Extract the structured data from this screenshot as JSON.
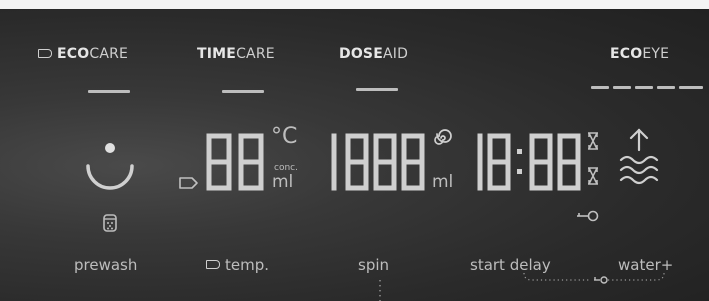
{
  "header": {
    "ecocare": {
      "bold": "ECO",
      "light": "CARE"
    },
    "timecare": {
      "bold": "TIME",
      "light": "CARE"
    },
    "doseaid": {
      "bold": "DOSE",
      "light": "AID"
    },
    "ecoeye": {
      "bold": "ECO",
      "light": "EYE"
    }
  },
  "displays": {
    "temperature": {
      "digits": "88",
      "unit": "°C",
      "sub_unit_small": "conc.",
      "sub_unit": "ml"
    },
    "dose": {
      "digits": "1888",
      "unit": "ml"
    },
    "time": {
      "digits": "18:88"
    }
  },
  "buttons": {
    "prewash": "prewash",
    "temp": "temp.",
    "spin": "spin",
    "start_delay": "start delay",
    "water_plus": "water+"
  },
  "icons": {
    "ecocare_tag": "tag-icon",
    "temp_tag": "tag-icon",
    "prewash": "power-dot-icon",
    "prewash_sub": "detergent-cup-icon",
    "dose_spiral": "spiral-icon",
    "hourglass_top": "hourglass-icon",
    "hourglass_bottom": "hourglass-icon",
    "key": "key-icon",
    "water": "water-waves-icon"
  },
  "colors": {
    "background": "#2b2b2b",
    "segments": "#c8c8c8",
    "text": "#bdbdbd"
  }
}
